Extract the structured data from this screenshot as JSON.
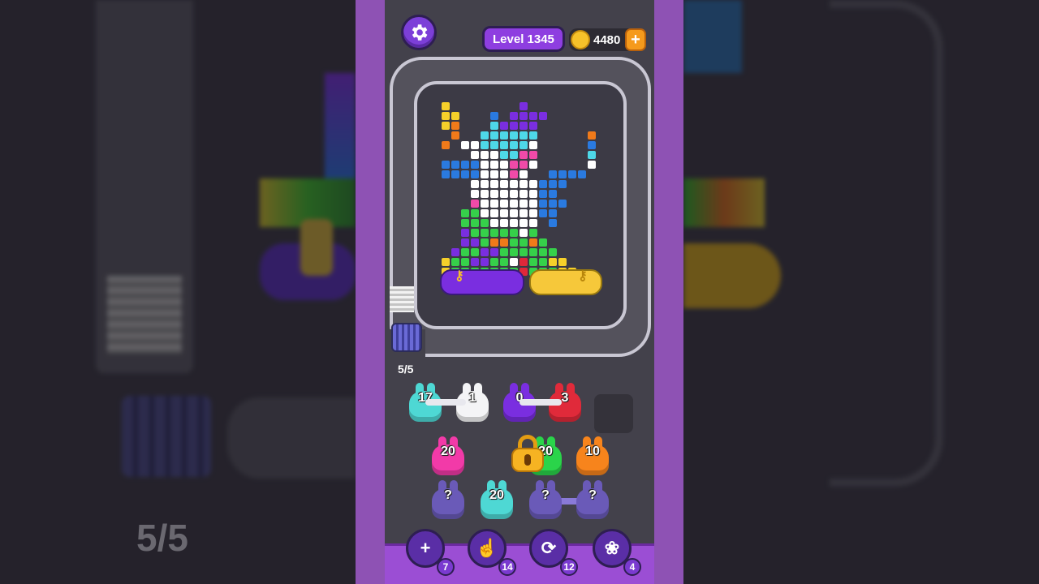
{
  "header": {
    "level_label": "Level 1345",
    "coins": "4480",
    "add_coins_label": "+"
  },
  "board": {
    "conveyor_counter": "5/5"
  },
  "slots_row": [
    {
      "count": "17",
      "color": "#4ed8d4"
    },
    {
      "count": "1",
      "color": "#f4f4f6"
    },
    {
      "count": "0",
      "color": "#7a2ee0"
    },
    {
      "count": "3",
      "color": "#e02a3a"
    }
  ],
  "queue_row1": [
    {
      "count": "20",
      "color": "#f23aa8"
    },
    {
      "count": "20",
      "color": "#2ad44a"
    },
    {
      "count": "10",
      "color": "#f7841c"
    }
  ],
  "queue_row2": [
    {
      "count": "?",
      "color": "#6a5ab8"
    },
    {
      "count": "20",
      "color": "#4ed8d4"
    },
    {
      "count": "?",
      "color": "#6a5ab8"
    },
    {
      "count": "?",
      "color": "#6a5ab8"
    }
  ],
  "tools": [
    {
      "name": "add-slot",
      "count": "7"
    },
    {
      "name": "hand",
      "count": "14"
    },
    {
      "name": "shuffle",
      "count": "12"
    },
    {
      "name": "bunny",
      "count": "4"
    }
  ],
  "side_counter": "5/5",
  "colors": {
    "purple_bg": "#8e52b4",
    "panel": "#43414b",
    "accent": "#7c3fd8"
  }
}
